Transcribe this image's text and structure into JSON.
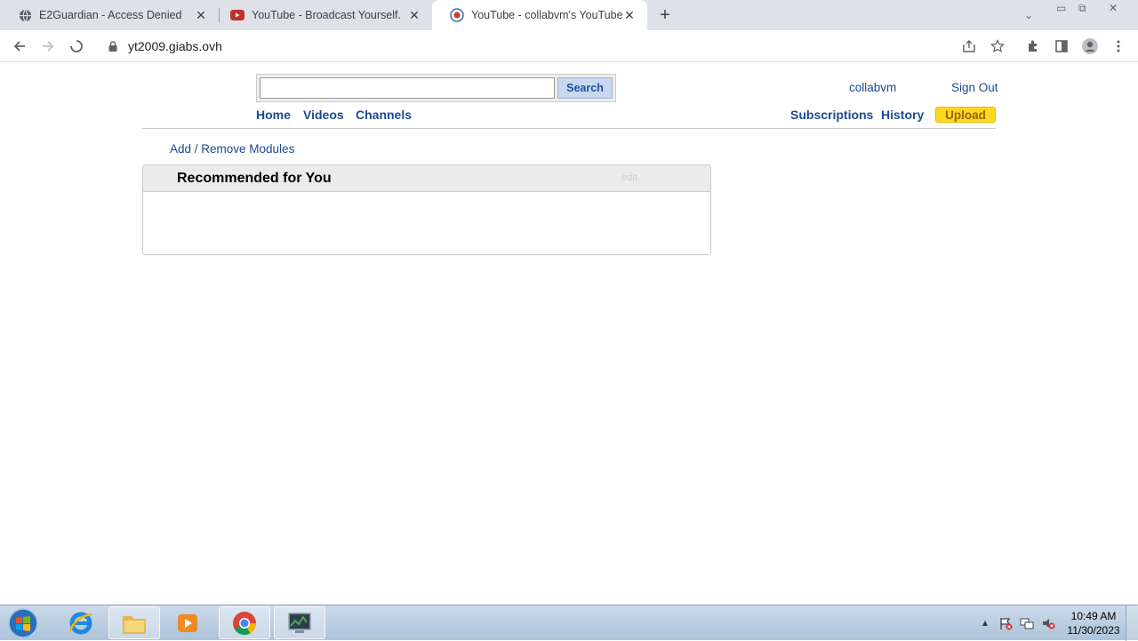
{
  "browser": {
    "tabs": [
      {
        "title": "E2Guardian - Access Denied",
        "icon": "globe-icon"
      },
      {
        "title": "YouTube - Broadcast Yourself.",
        "icon": "youtube-icon"
      },
      {
        "title": "YouTube - collabvm's YouTube",
        "icon": "collabvm-icon",
        "active": true
      }
    ],
    "url": "yt2009.giabs.ovh"
  },
  "page": {
    "search": {
      "value": "",
      "button_label": "Search"
    },
    "nav": {
      "home": "Home",
      "videos": "Videos",
      "channels": "Channels"
    },
    "account": {
      "username": "collabvm",
      "sign_out": "Sign Out"
    },
    "user_nav": {
      "subscriptions": "Subscriptions",
      "history": "History",
      "upload": "Upload"
    },
    "modules_link": "Add / Remove Modules",
    "module": {
      "title": "Recommended for You",
      "edit_label": "edit"
    }
  },
  "taskbar": {
    "items": [
      "internet-explorer-icon",
      "file-explorer-icon",
      "media-player-icon",
      "chrome-icon",
      "task-manager-icon"
    ],
    "clock": {
      "time": "10:49 AM",
      "date": "11/30/2023"
    }
  },
  "colors": {
    "link": "#1c4a92",
    "upload_bg": "#fed81e",
    "tabstrip": "#dee1e6"
  }
}
